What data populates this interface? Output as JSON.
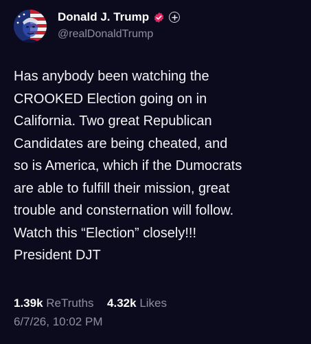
{
  "author": {
    "display_name": "Donald J. Trump",
    "handle": "@realDonaldTrump",
    "verified_badge_color": "#e0245e",
    "avatar_icon": "avatar-portrait-icon"
  },
  "post": {
    "text": "Has anybody been watching the\nCROOKED Election going on in\nCalifornia. Two great Republican\nCandidates are being cheated, and\nso is America, which if the Dumocrats\nare able to fulfill their mission, great\ntrouble and consternation will follow.\nWatch this “Election” closely!!!\nPresident DJT"
  },
  "stats": {
    "retruths_count": "1.39k",
    "retruths_label": "ReTruths",
    "likes_count": "4.32k",
    "likes_label": "Likes"
  },
  "timestamp": "6/7/26, 10:02 PM",
  "colors": {
    "background": "#0c0b1d",
    "text": "#f2f2f5",
    "muted": "#8f8fa3"
  }
}
